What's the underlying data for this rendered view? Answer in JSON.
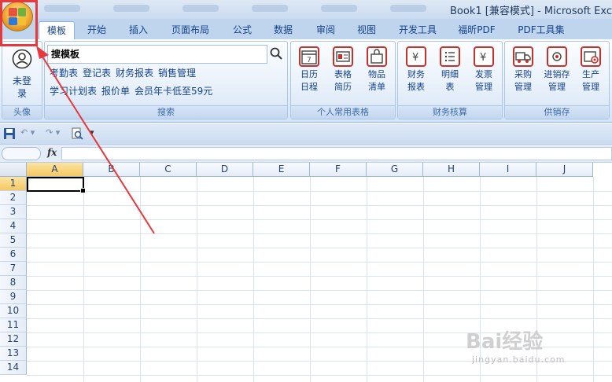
{
  "window": {
    "title": "Book1  [兼容模式] - Microsoft Exc"
  },
  "tabs": [
    {
      "label": "模板",
      "active": true
    },
    {
      "label": "开始"
    },
    {
      "label": "插入"
    },
    {
      "label": "页面布局"
    },
    {
      "label": "公式"
    },
    {
      "label": "数据"
    },
    {
      "label": "审阅"
    },
    {
      "label": "视图"
    },
    {
      "label": "开发工具"
    },
    {
      "label": "福昕PDF"
    },
    {
      "label": "PDF工具集"
    }
  ],
  "ribbon": {
    "avatar_group": {
      "label_line1": "未登",
      "label_line2": "录",
      "group_label": "头像"
    },
    "search_group": {
      "search_value": "搜模板",
      "chips_row1": [
        "考勤表",
        "登记表",
        "财务报表",
        "销售管理"
      ],
      "chips_row2": [
        "学习计划表",
        "报价单",
        "会员年卡低至59元"
      ],
      "group_label": "搜索"
    },
    "personal_group": {
      "buttons": [
        {
          "line1": "日历",
          "line2": "日程",
          "icon": "calendar-icon"
        },
        {
          "line1": "表格",
          "line2": "简历",
          "icon": "resume-icon"
        },
        {
          "line1": "物品",
          "line2": "清单",
          "icon": "shopping-bag-icon"
        }
      ],
      "group_label": "个人常用表格"
    },
    "finance_group": {
      "buttons": [
        {
          "line1": "财务",
          "line2": "报表",
          "icon": "yen-report-icon"
        },
        {
          "line1": "明细",
          "line2": "表",
          "icon": "list-icon"
        },
        {
          "line1": "发票",
          "line2": "管理",
          "icon": "invoice-icon"
        }
      ],
      "group_label": "财务核算"
    },
    "supply_group": {
      "buttons": [
        {
          "line1": "采购",
          "line2": "管理",
          "icon": "truck-icon"
        },
        {
          "line1": "进销存",
          "line2": "管理",
          "icon": "inventory-icon"
        },
        {
          "line1": "生产",
          "line2": "管理",
          "icon": "production-icon"
        }
      ],
      "group_label": "供销存"
    }
  },
  "formula_bar": {
    "fx_label": "fx"
  },
  "grid": {
    "columns": [
      "A",
      "B",
      "C",
      "D",
      "E",
      "F",
      "G",
      "H",
      "I",
      "J"
    ],
    "rows": [
      "1",
      "2",
      "3",
      "4",
      "5",
      "6",
      "7",
      "8",
      "9",
      "10",
      "11",
      "12",
      "13",
      "14"
    ],
    "selected_column": "A",
    "selected_row": "1"
  },
  "colors": {
    "accent_red": "#e8383c",
    "ribbon_text": "#15428b"
  },
  "watermark": {
    "brand": "Bai经验",
    "url": "jingyan.baidu.com"
  }
}
